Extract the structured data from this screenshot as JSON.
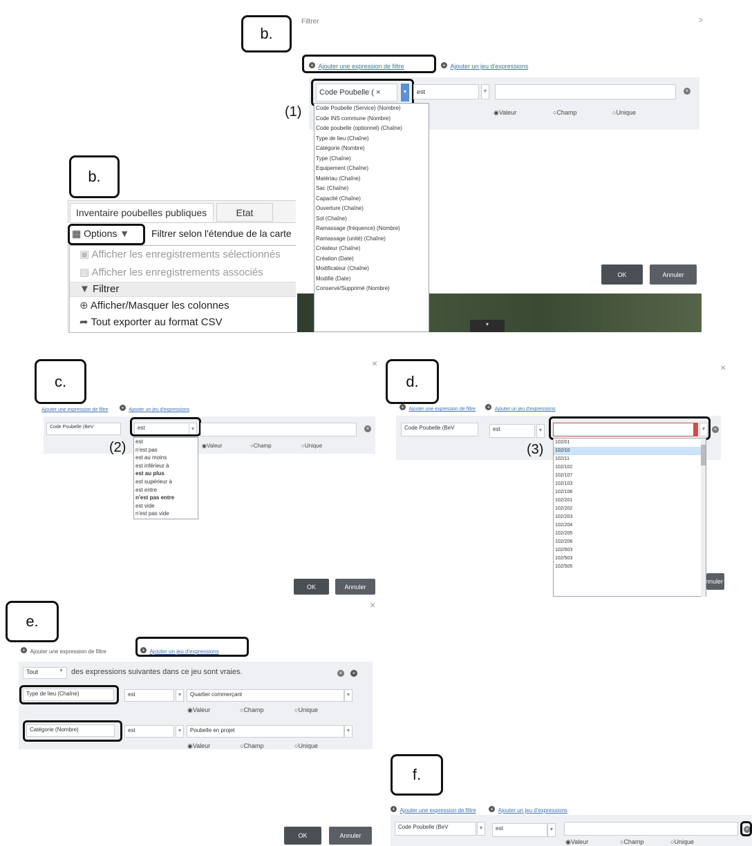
{
  "labels": {
    "b_top": "b.",
    "b_side": "b.",
    "c": "c.",
    "d": "d.",
    "e": "e.",
    "f": "f."
  },
  "steps": {
    "s1": "(1)",
    "s2": "(2)",
    "s3": "(3)"
  },
  "common": {
    "add_expression": "Ajouter une expression de filtre",
    "add_set": "Ajouter un jeu d'expressions",
    "radio_value": "Valeur",
    "radio_field": "Champ",
    "radio_unique": "Unique",
    "ok": "OK",
    "cancel": "Annuler",
    "operator": "est",
    "close": "×"
  },
  "panel_b": {
    "title": "Filtrer",
    "close": ">",
    "field_value": "Code Poubelle (",
    "field_clear": "×",
    "fields": [
      "Code Poubelle (Service) (Nombre)",
      "Code INS commune (Nombre)",
      "Code poubelle (optionnel) (Chaîne)",
      "Type de lieu (Chaîne)",
      "Catégorie (Nombre)",
      "Type (Chaîne)",
      "Equipement (Chaîne)",
      "Matériau (Chaîne)",
      "Sac (Chaîne)",
      "Capacité (Chaîne)",
      "Ouverture (Chaîne)",
      "Sol (Chaîne)",
      "Ramassage (fréquence) (Nombre)",
      "Ramassage (unité) (Chaîne)",
      "Créateur (Chaîne)",
      "Création (Date)",
      "Modificateur (Chaîne)",
      "Modifié (Date)",
      "Conservé/Supprimé (Nombre)"
    ]
  },
  "table_window": {
    "tab1": "Inventaire poubelles publiques",
    "tab2": "Etat",
    "options": "Options",
    "filter_extent": "Filtrer selon l'étendue de la carte",
    "menu": [
      "Afficher les enregistrements sélectionnés",
      "Afficher les enregistrements associés",
      "Filtrer",
      "Afficher/Masquer les colonnes",
      "Tout exporter au format CSV"
    ]
  },
  "panel_c": {
    "field": "Code Poubelle (BeV",
    "operators": [
      "est",
      "n'est pas",
      "est au moins",
      "est inférieur à",
      "est au plus",
      "est supérieur à",
      "est entre",
      "n'est pas entre",
      "est vide",
      "n'est pas vide"
    ]
  },
  "panel_d": {
    "field": "Code Poubelle (BeV",
    "values": [
      "102/01",
      "102/10",
      "102/11",
      "102/102",
      "102/107",
      "102/103",
      "102/106",
      "102/201",
      "102/202",
      "102/203",
      "102/204",
      "102/205",
      "102/206",
      "102/503",
      "102/503",
      "102/505"
    ]
  },
  "panel_e": {
    "all": "Tout",
    "sentence": "des expressions suivantes dans ce jeu sont vraies.",
    "row1_field": "Type de lieu (Chaîne)",
    "row1_value": "Quartier commerçant",
    "row2_field": "Catégorie (Nombre)",
    "row2_value": "Poubelle en projet"
  },
  "panel_f": {
    "field": "Code Poubelle (BeV"
  },
  "colors": {
    "panel_bg": "#eef0f3",
    "link": "#3b6fb6",
    "button": "#4a4f55",
    "selected_row": "#cde3f7"
  }
}
